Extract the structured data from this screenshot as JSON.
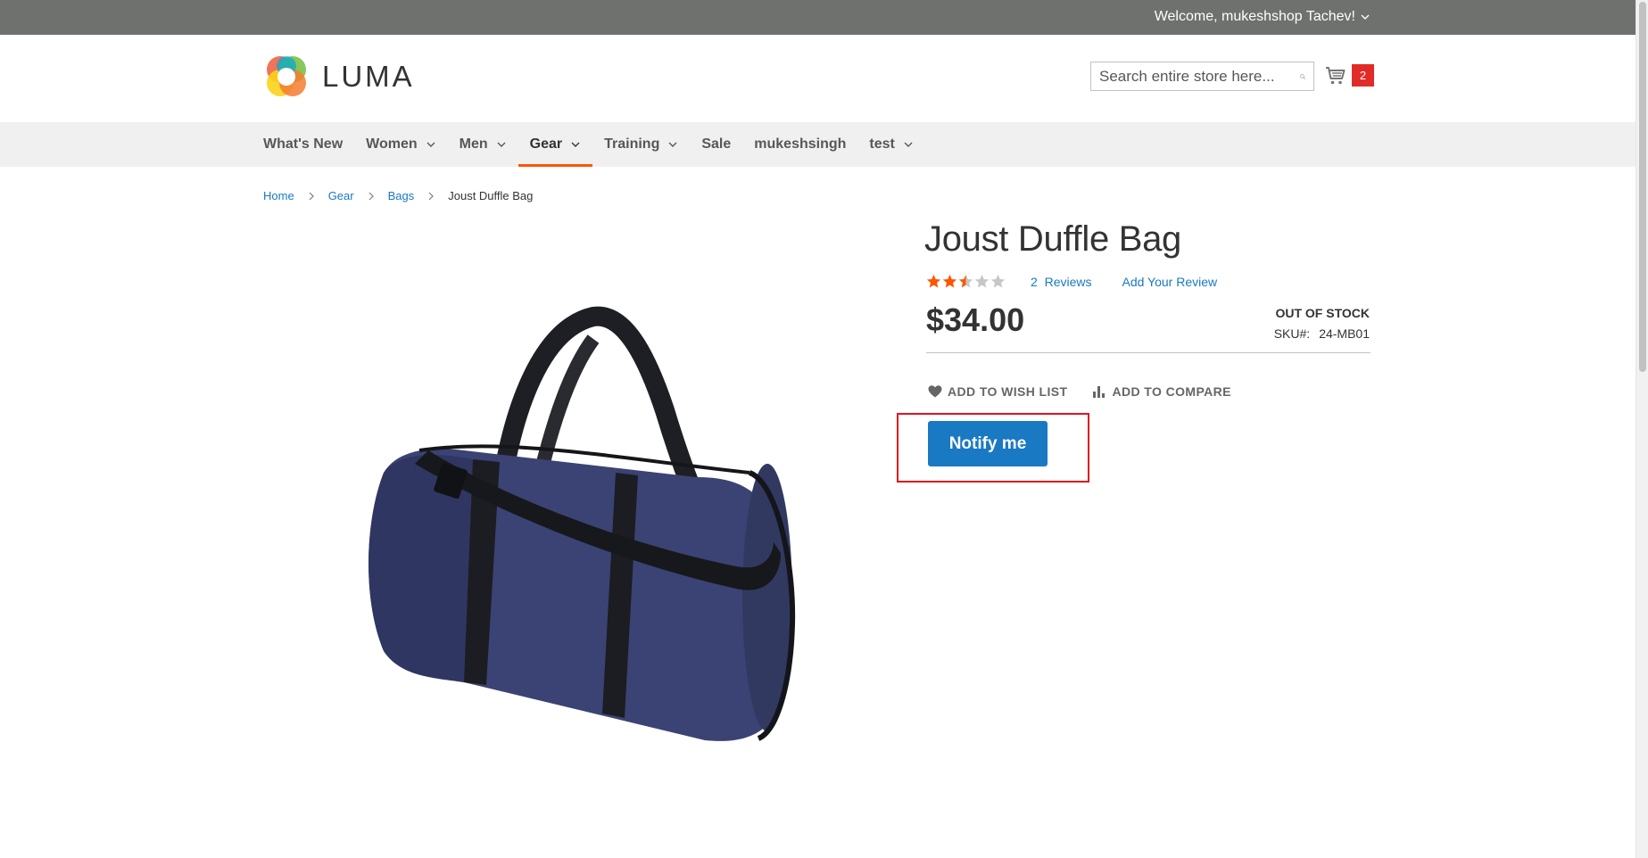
{
  "header": {
    "welcome": "Welcome, mukeshshop Tachev!",
    "logo_text": "LUMA",
    "search_placeholder": "Search entire store here...",
    "cart_count": "2"
  },
  "nav": {
    "items": [
      {
        "label": "What's New"
      },
      {
        "label": "Women"
      },
      {
        "label": "Men"
      },
      {
        "label": "Gear"
      },
      {
        "label": "Training"
      },
      {
        "label": "Sale"
      },
      {
        "label": "mukeshsingh"
      },
      {
        "label": "test"
      }
    ]
  },
  "breadcrumb": {
    "items": [
      "Home",
      "Gear",
      "Bags"
    ],
    "current": "Joust Duffle Bag"
  },
  "product": {
    "title": "Joust Duffle Bag",
    "rating_fraction": 0.5,
    "reviews_count": "2",
    "reviews_label": "Reviews",
    "add_review": "Add Your Review",
    "price": "$34.00",
    "stock": "OUT OF STOCK",
    "sku_label": "SKU#:",
    "sku": "24-MB01",
    "wishlist": "ADD TO WISH LIST",
    "compare": "ADD TO COMPARE",
    "notify": "Notify me"
  },
  "colors": {
    "link": "#1979c3",
    "primary_button": "#1979c3",
    "cart_badge": "#e02b27",
    "nav_active": "#ff5501",
    "star_filled": "#ff5501",
    "star_empty": "#c7c7c7",
    "highlight": "#e1141e"
  }
}
